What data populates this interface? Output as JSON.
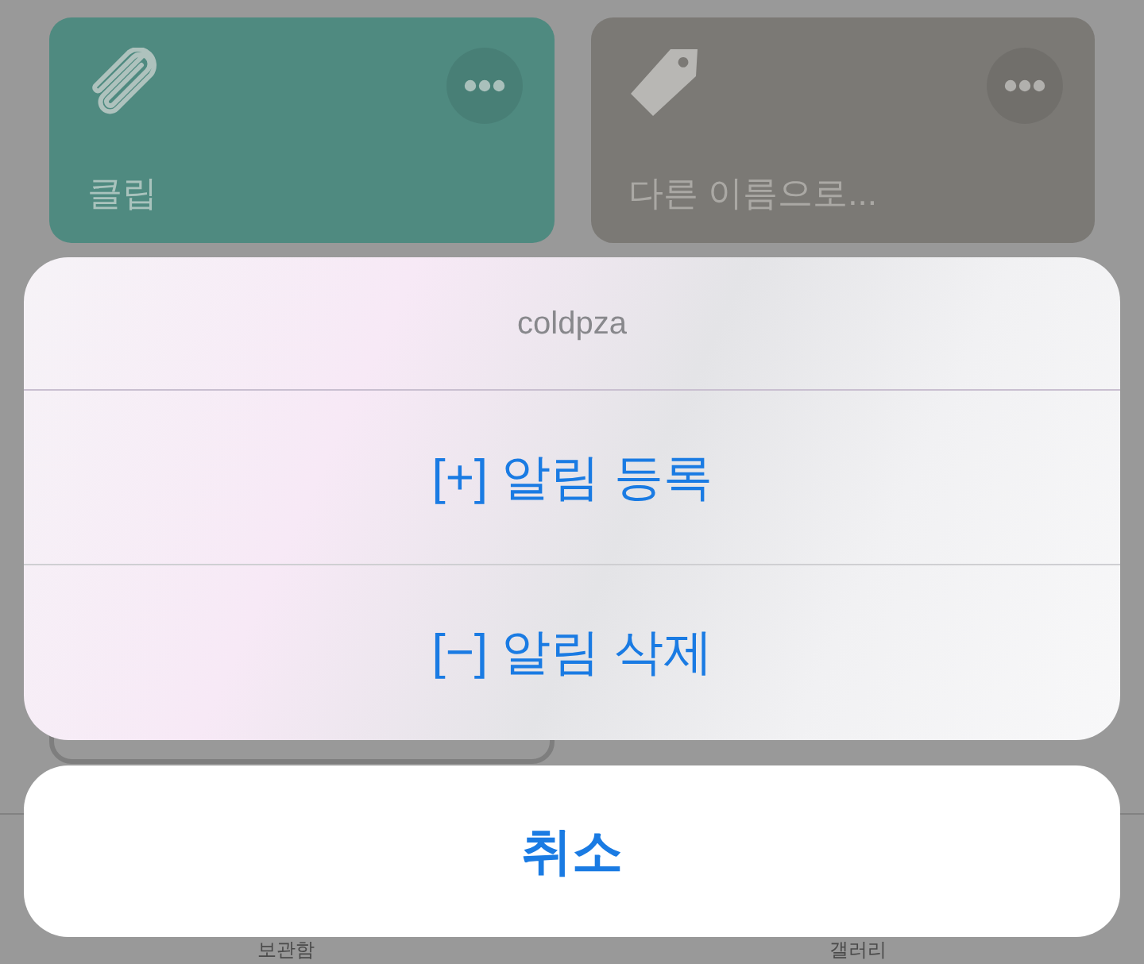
{
  "cards": [
    {
      "kind": "clip",
      "label": "클립",
      "color": "#4f8a80"
    },
    {
      "kind": "tag",
      "label": "다른 이름으로...",
      "color": "#7b7975"
    }
  ],
  "tab_bar": {
    "items": [
      {
        "label": "보관함"
      },
      {
        "label": "갤러리"
      }
    ]
  },
  "action_sheet": {
    "title": "coldpza",
    "actions": [
      {
        "label": "[+] 알림 등록"
      },
      {
        "label": "[−] 알림 삭제"
      }
    ],
    "cancel": {
      "label": "취소"
    }
  }
}
